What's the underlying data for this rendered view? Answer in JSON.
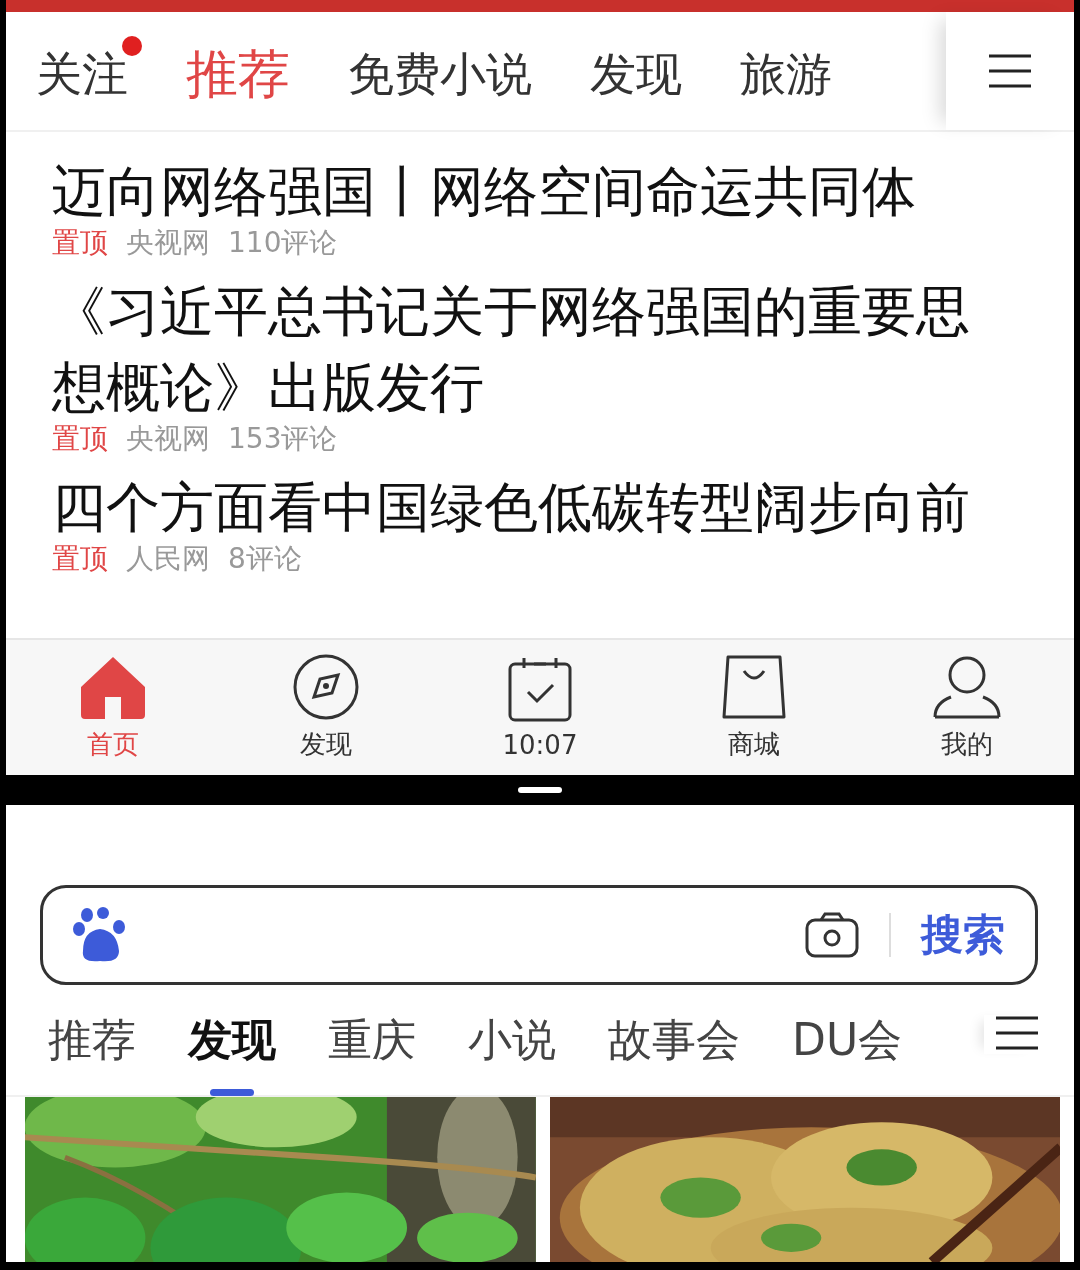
{
  "top_tabs": [
    {
      "label": "关注",
      "selected": false,
      "badge": true
    },
    {
      "label": "推荐",
      "selected": true,
      "badge": false
    },
    {
      "label": "免费小说",
      "selected": false,
      "badge": false
    },
    {
      "label": "发现",
      "selected": false,
      "badge": false
    },
    {
      "label": "旅游",
      "selected": false,
      "badge": false
    }
  ],
  "news": [
    {
      "title": "迈向网络强国丨网络空间命运共同体",
      "tag": "置顶",
      "source": "央视网",
      "comments": "110评论"
    },
    {
      "title": "《习近平总书记关于网络强国的重要思想概论》出版发行",
      "tag": "置顶",
      "source": "央视网",
      "comments": "153评论"
    },
    {
      "title": "四个方面看中国绿色低碳转型阔步向前",
      "tag": "置顶",
      "source": "人民网",
      "comments": "8评论"
    }
  ],
  "bottom_nav": [
    {
      "label": "首页",
      "selected": true
    },
    {
      "label": "发现",
      "selected": false
    },
    {
      "label": "10:07",
      "selected": false
    },
    {
      "label": "商城",
      "selected": false
    },
    {
      "label": "我的",
      "selected": false
    }
  ],
  "search": {
    "button": "搜索"
  },
  "feed_tabs": [
    {
      "label": "推荐",
      "selected": false
    },
    {
      "label": "发现",
      "selected": true
    },
    {
      "label": "重庆",
      "selected": false
    },
    {
      "label": "小说",
      "selected": false
    },
    {
      "label": "故事会",
      "selected": false
    },
    {
      "label": "DU会",
      "selected": false
    }
  ]
}
